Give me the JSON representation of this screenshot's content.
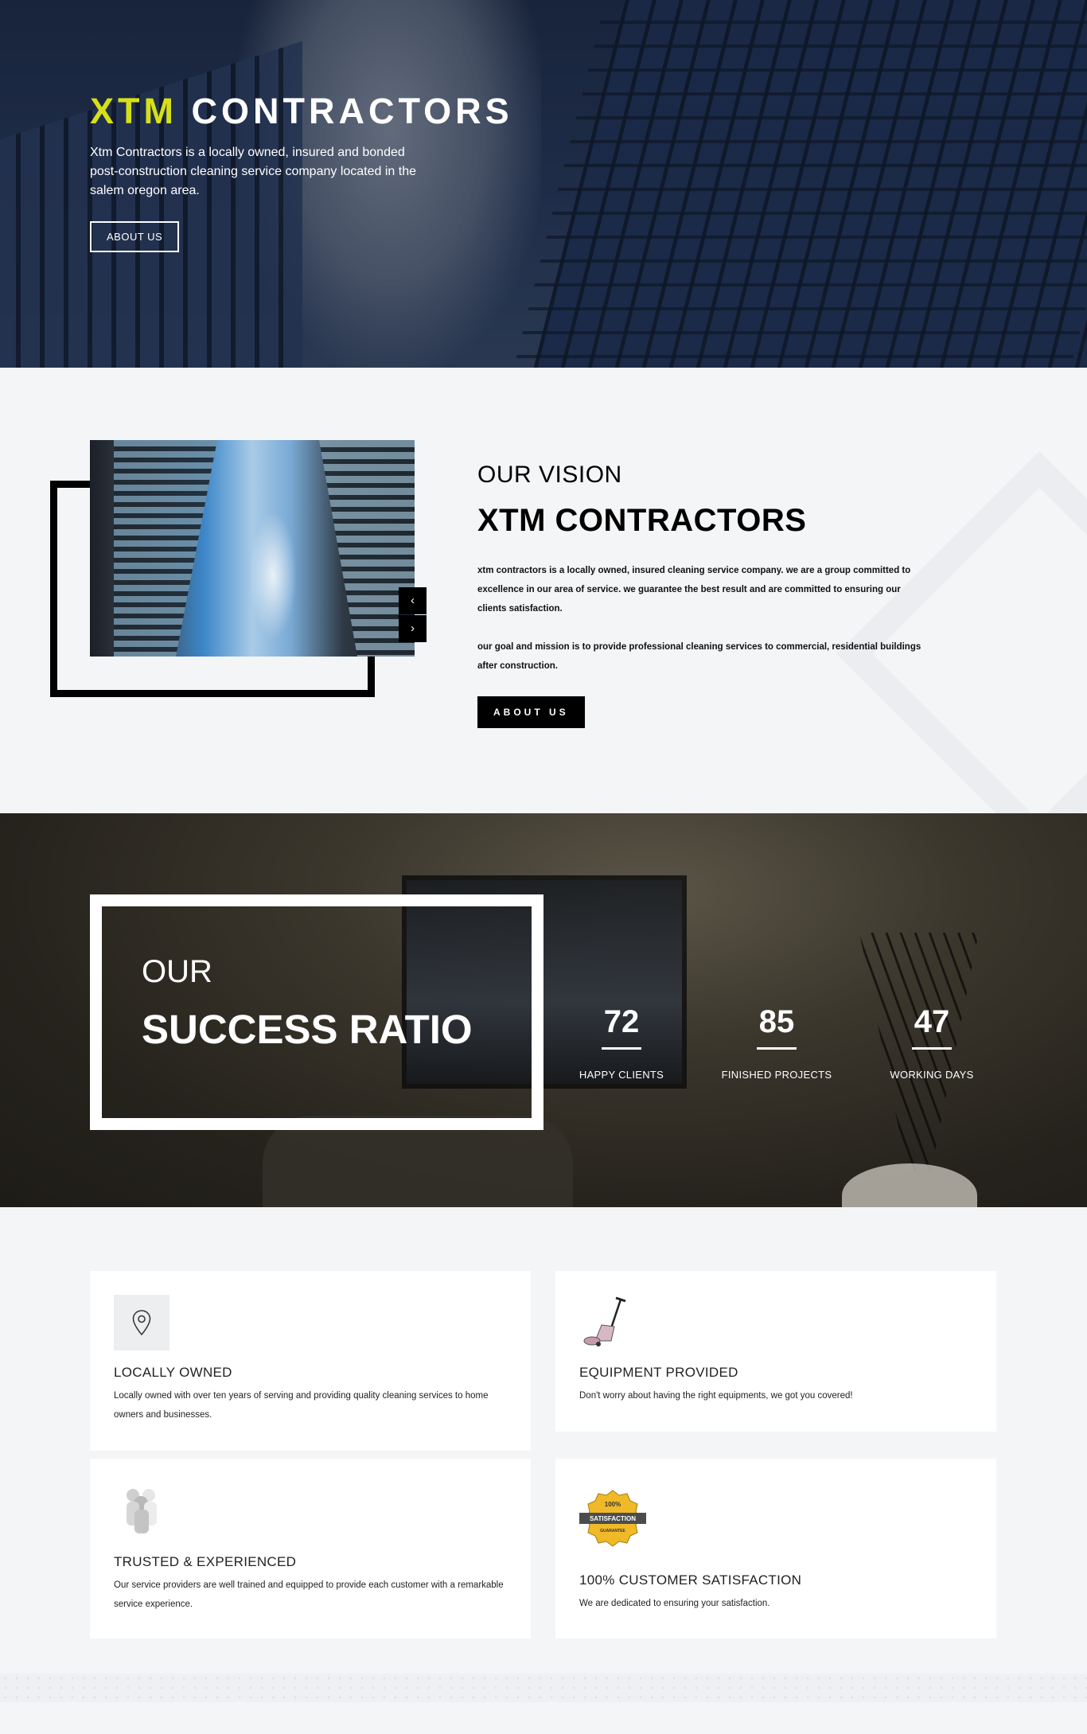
{
  "hero": {
    "title_accent": "XTM",
    "title_rest": "CONTRACTORS",
    "description": "Xtm Contractors is a locally owned, insured and bonded post-construction cleaning service company located in the salem oregon area.",
    "button_label": "ABOUT US"
  },
  "vision": {
    "subtitle": "OUR VISION",
    "title": "XTM CONTRACTORS",
    "paragraph1": "xtm contractors is a locally owned, insured cleaning service company. we are a group committed to excellence in our area of service. we guarantee the best result and are committed to ensuring our clients satisfaction.",
    "paragraph2": "our goal and mission is to provide professional cleaning services to commercial, residential buildings after construction.",
    "button_label": "ABOUT US",
    "slider_prev": "‹",
    "slider_next": "›"
  },
  "success": {
    "subtitle": "OUR",
    "title": "SUCCESS RATIO",
    "stats": [
      {
        "value": "72",
        "label": "HAPPY CLIENTS"
      },
      {
        "value": "85",
        "label": "FINISHED PROJECTS"
      },
      {
        "value": "47",
        "label": "WORKING DAYS"
      }
    ]
  },
  "features": [
    {
      "title": "LOCALLY OWNED",
      "description": "Locally owned with over ten years of serving and providing quality cleaning services to home owners and businesses.",
      "icon": "location-pin-icon"
    },
    {
      "title": "EQUIPMENT PROVIDED",
      "description": "Don't worry about having the right equipments, we got you covered!",
      "icon": "vacuum-icon"
    },
    {
      "title": "TRUSTED & EXPERIENCED",
      "description": "Our service providers are well trained and equipped to provide each customer with a remarkable service experience.",
      "icon": "team-figures-icon"
    },
    {
      "title": "100% CUSTOMER SATISFACTION",
      "description": "We are dedicated to ensuring your satisfaction.",
      "icon": "satisfaction-badge-icon",
      "badge_text_top": "100%",
      "badge_text_mid": "SATISFACTION",
      "badge_text_bottom": "GUARANTEE"
    }
  ],
  "colors": {
    "accent": "#d7e016",
    "dark": "#000000",
    "background": "#f4f5f7"
  }
}
